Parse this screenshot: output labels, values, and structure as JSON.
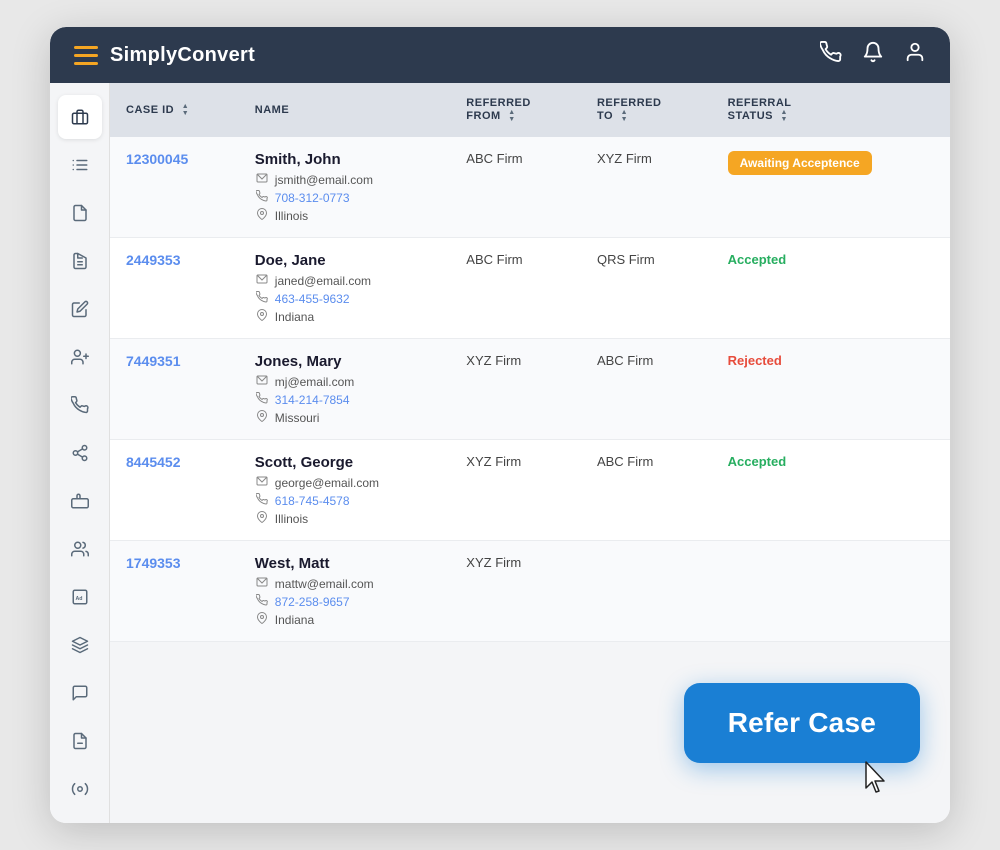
{
  "header": {
    "title": "SimplyConvert",
    "icons": [
      "phone",
      "bell",
      "user"
    ]
  },
  "sidebar": {
    "items": [
      {
        "name": "briefcase",
        "icon": "💼",
        "active": true
      },
      {
        "name": "filter",
        "icon": "🔀",
        "active": false
      },
      {
        "name": "document",
        "icon": "📄",
        "active": false
      },
      {
        "name": "document2",
        "icon": "📋",
        "active": false
      },
      {
        "name": "edit",
        "icon": "✏️",
        "active": false
      },
      {
        "name": "add-user",
        "icon": "👤",
        "active": false
      },
      {
        "name": "phone",
        "icon": "📞",
        "active": false
      },
      {
        "name": "share",
        "icon": "↗️",
        "active": false
      },
      {
        "name": "suitcase",
        "icon": "🧳",
        "active": false
      },
      {
        "name": "group",
        "icon": "👥",
        "active": false
      },
      {
        "name": "ad",
        "icon": "📢",
        "active": false
      },
      {
        "name": "layers",
        "icon": "📚",
        "active": false
      },
      {
        "name": "chat",
        "icon": "💬",
        "active": false
      },
      {
        "name": "report",
        "icon": "📊",
        "active": false
      },
      {
        "name": "settings",
        "icon": "⚙️",
        "active": false
      }
    ]
  },
  "table": {
    "columns": [
      {
        "key": "case_id",
        "label": "CASE ID",
        "sortable": true
      },
      {
        "key": "name",
        "label": "NAME",
        "sortable": false
      },
      {
        "key": "referred_from",
        "label": "REFERRED FROM",
        "sortable": true
      },
      {
        "key": "referred_to",
        "label": "REFERRED TO",
        "sortable": true
      },
      {
        "key": "referral_status",
        "label": "REFERRAL STATUS",
        "sortable": true
      }
    ],
    "rows": [
      {
        "case_id": "12300045",
        "name": "Smith, John",
        "email": "jsmith@email.com",
        "phone": "708-312-0773",
        "location": "Illinois",
        "referred_from": "ABC Firm",
        "referred_to": "XYZ Firm",
        "status": "Awaiting Acceptence",
        "status_type": "awaiting"
      },
      {
        "case_id": "2449353",
        "name": "Doe, Jane",
        "email": "janed@email.com",
        "phone": "463-455-9632",
        "location": "Indiana",
        "referred_from": "ABC Firm",
        "referred_to": "QRS Firm",
        "status": "Accepted",
        "status_type": "accepted"
      },
      {
        "case_id": "7449351",
        "name": "Jones, Mary",
        "email": "mj@email.com",
        "phone": "314-214-7854",
        "location": "Missouri",
        "referred_from": "XYZ Firm",
        "referred_to": "ABC Firm",
        "status": "Rejected",
        "status_type": "rejected"
      },
      {
        "case_id": "8445452",
        "name": "Scott, George",
        "email": "george@email.com",
        "phone": "618-745-4578",
        "location": "Illinois",
        "referred_from": "XYZ Firm",
        "referred_to": "ABC Firm",
        "status": "Accepted",
        "status_type": "accepted"
      },
      {
        "case_id": "1749353",
        "name": "West, Matt",
        "email": "mattw@email.com",
        "phone": "872-258-9657",
        "location": "Indiana",
        "referred_from": "XYZ Firm",
        "referred_to": "",
        "status": "",
        "status_type": ""
      }
    ]
  },
  "refer_case_button": "Refer Case"
}
